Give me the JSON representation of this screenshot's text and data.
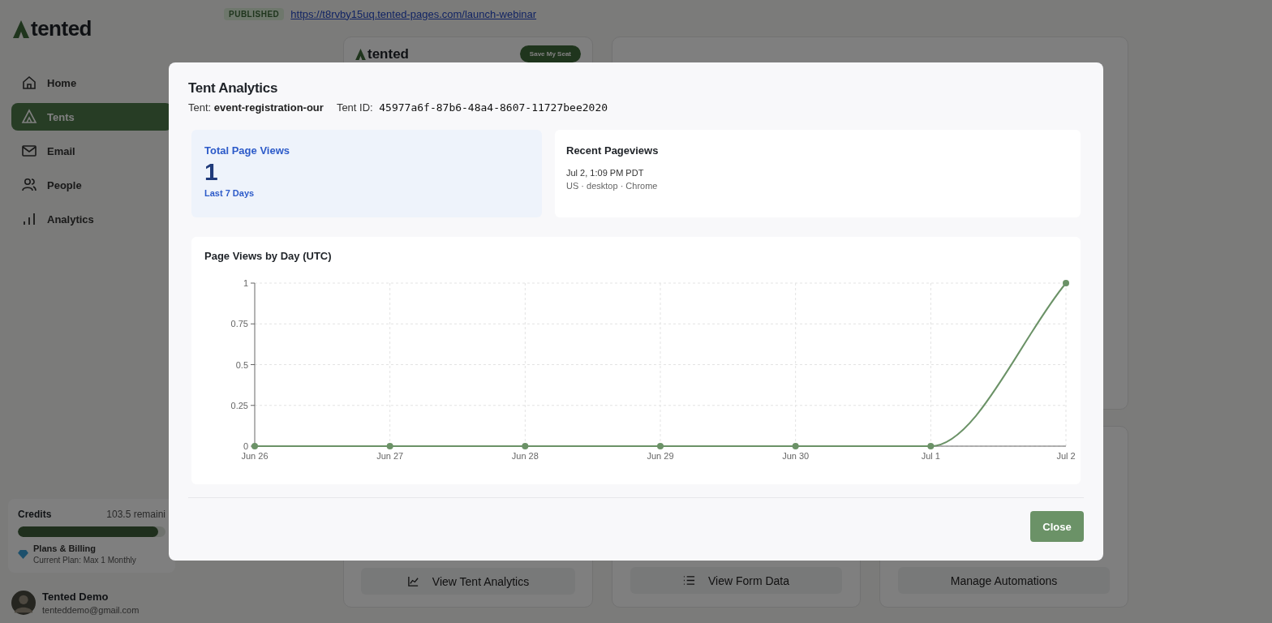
{
  "sidebar": {
    "logo": "tented",
    "nav": [
      {
        "label": "Home",
        "kind": "home",
        "selected": false
      },
      {
        "label": "Tents",
        "kind": "tent",
        "selected": true
      },
      {
        "label": "Email",
        "kind": "mail",
        "selected": false
      },
      {
        "label": "People",
        "kind": "people",
        "selected": false
      },
      {
        "label": "Analytics",
        "kind": "bars",
        "selected": false
      }
    ],
    "credits": {
      "label": "Credits",
      "remaining": "103.5 remaini",
      "level": 0.95,
      "plan": "Plans & Billing",
      "plan_detail": "Current Plan: Max 1 Monthly"
    },
    "user": {
      "name": "Tented Demo",
      "email": "tenteddemo@gmail.com"
    }
  },
  "topbar": {
    "status": "PUBLISHED",
    "url": "https://t8rvby15uq.tented-pages.com/launch-webinar"
  },
  "preview": {
    "logo": "tented",
    "button": "Save My Seat"
  },
  "actions": [
    {
      "label": "View Tent Analytics",
      "kind": "chart"
    },
    {
      "label": "View Form Data",
      "kind": "list"
    },
    {
      "label": "Manage Automations",
      "kind": "plain"
    }
  ],
  "modal": {
    "title": "Tent Analytics",
    "tent_label": "Tent:",
    "tent_value": "event-registration-our",
    "id_label": "Tent ID:",
    "id_value": "45977a6f-87b6-48a4-8607-11727bee2020",
    "stat": {
      "label": "Total Page Views",
      "value": "1",
      "caption": "Last 7 Days"
    },
    "recent": {
      "title": "Recent Pageviews",
      "entries": [
        {
          "time": "Jul 2, 1:09 PM PDT",
          "meta": "US · desktop · Chrome"
        }
      ]
    },
    "chart": {
      "title": "Page Views by Day (UTC)",
      "chart_data": {
        "type": "line",
        "categories": [
          "Jun 26",
          "Jun 27",
          "Jun 28",
          "Jun 29",
          "Jun 30",
          "Jul 1",
          "Jul 2"
        ],
        "series": [
          {
            "color": "#6b9267",
            "marker": true,
            "values": [
              0,
              0,
              0,
              0,
              0,
              0,
              1
            ]
          }
        ],
        "grid": true,
        "ylim": [
          0,
          1
        ],
        "yticks": [
          0,
          0.25,
          0.5,
          0.75,
          1
        ]
      }
    },
    "close": "Close"
  }
}
